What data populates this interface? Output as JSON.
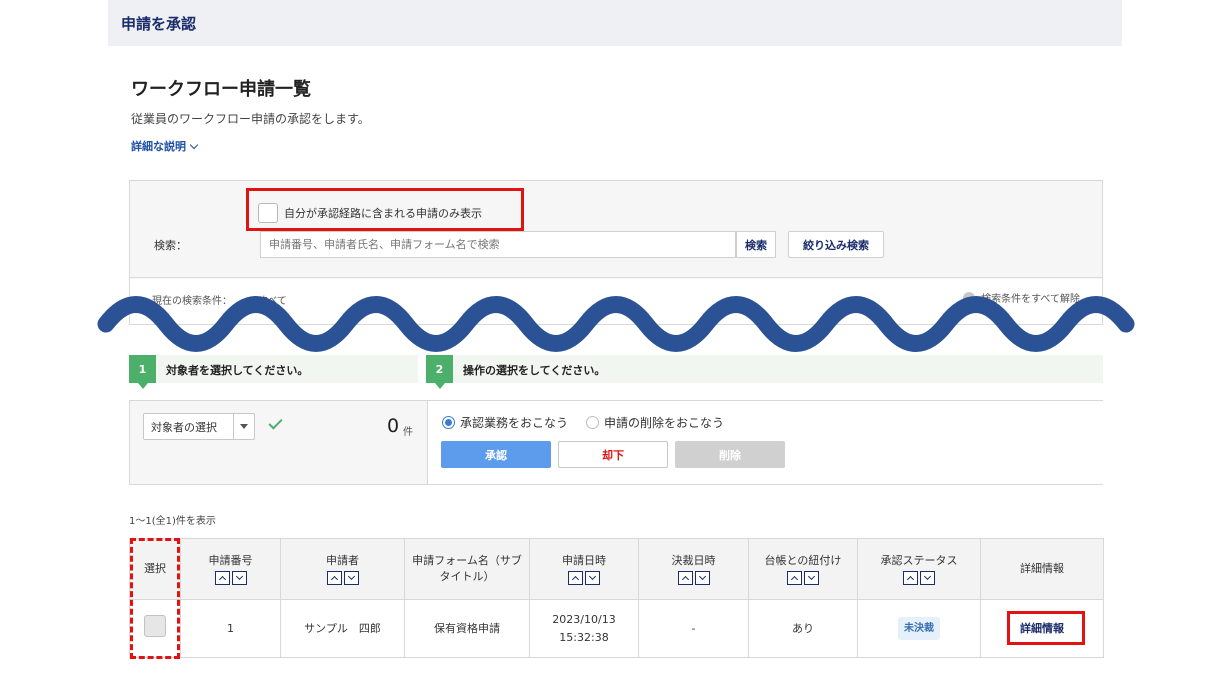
{
  "header": {
    "title": "申請を承認"
  },
  "page": {
    "title": "ワークフロー申請一覧",
    "description": "従業員のワークフロー申請の承認をします。",
    "detail_link": "詳細な説明"
  },
  "search": {
    "only_mine_label": "自分が承認経路に含まれる申請のみ表示",
    "label": "検索：",
    "placeholder": "申請番号、申請者氏名、申請フォーム名で検索",
    "search_button": "検索",
    "filter_button": "絞り込み検索",
    "condition_label": "現在の検索条件：",
    "condition_value": "すべて",
    "clear_label": "検索条件をすべて解除"
  },
  "steps": [
    {
      "num": "1",
      "text": "対象者を選択してください。"
    },
    {
      "num": "2",
      "text": "操作の選択をしてください。"
    }
  ],
  "operation": {
    "target_select": "対象者の選択",
    "count": "0",
    "count_unit": "件",
    "radio_approve": "承認業務をおこなう",
    "radio_delete": "申請の削除をおこなう",
    "approve_button": "承認",
    "reject_button": "却下",
    "delete_button": "削除"
  },
  "results": {
    "info": "1〜1(全1)件を表示"
  },
  "table": {
    "columns": [
      "選択",
      "申請番号",
      "申請者",
      "申請フォーム名（サブタイトル）",
      "申請日時",
      "決裁日時",
      "台帳との紐付け",
      "承認ステータス",
      "詳細情報"
    ],
    "rows": [
      {
        "number": "1",
        "applicant": "サンプル　四郎",
        "form": "保有資格申請",
        "date": "2023/10/13",
        "time": "15:32:38",
        "decided": "-",
        "ledger": "あり",
        "status": "未決裁",
        "detail": "詳細情報"
      }
    ]
  },
  "colors": {
    "navy": "#1a2c6b",
    "wave": "#2c5296",
    "highlight": "#e01212",
    "step": "#4caf6a"
  }
}
